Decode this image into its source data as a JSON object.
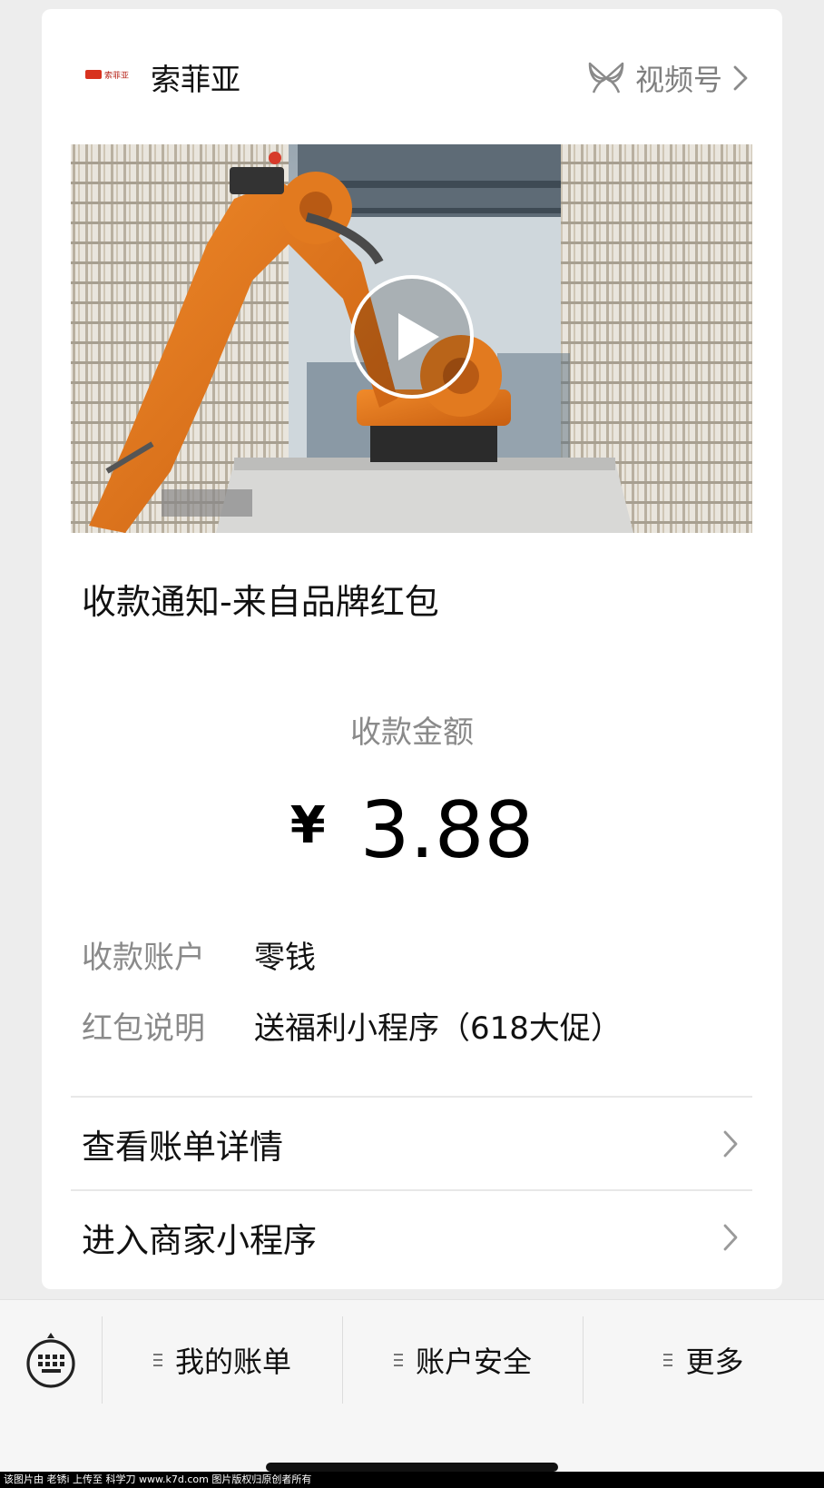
{
  "brand": {
    "logo_text": "索菲亚",
    "name": "索菲亚",
    "channels_label": "视频号"
  },
  "video": {
    "play_icon": "play-icon"
  },
  "notice": {
    "title": "收款通知-来自品牌红包"
  },
  "amount": {
    "label": "收款金额",
    "currency": "¥",
    "value": "3.88"
  },
  "details": {
    "account_label": "收款账户",
    "account_value": "零钱",
    "remark_label": "红包说明",
    "remark_value": "送福利小程序（618大促）"
  },
  "links": [
    {
      "label": "查看账单详情"
    },
    {
      "label": "进入商家小程序"
    }
  ],
  "bottom_menu": {
    "items": [
      {
        "label": "我的账单"
      },
      {
        "label": "账户安全"
      },
      {
        "label": "更多"
      }
    ]
  },
  "watermark": "该图片由 老锈i 上传至 科学刀 www.k7d.com 图片版权归原创者所有",
  "colors": {
    "page_bg": "#ededed",
    "card_bg": "#ffffff",
    "muted_text": "#8a8a8a",
    "robot_orange": "#e2761c"
  }
}
